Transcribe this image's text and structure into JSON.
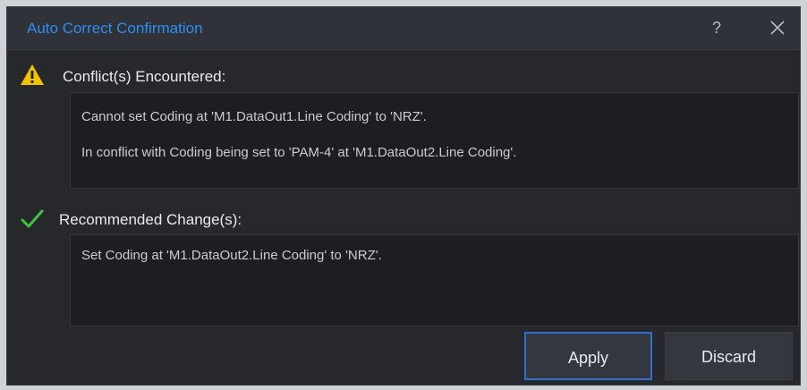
{
  "dialog": {
    "title": "Auto Correct Confirmation",
    "help_label": "?",
    "accent_color": "#2f8df0"
  },
  "conflict": {
    "heading": "Conflict(s) Encountered:",
    "icon": "warning-icon",
    "lines": [
      "Cannot set Coding at 'M1.DataOut1.Line Coding' to 'NRZ'.",
      "In conflict with Coding being set to 'PAM-4' at 'M1.DataOut2.Line Coding'."
    ]
  },
  "recommended": {
    "heading": "Recommended Change(s):",
    "icon": "checkmark-icon",
    "lines": [
      "Set Coding at 'M1.DataOut2.Line Coding' to 'NRZ'."
    ]
  },
  "buttons": {
    "apply_label": "Apply",
    "discard_label": "Discard"
  }
}
